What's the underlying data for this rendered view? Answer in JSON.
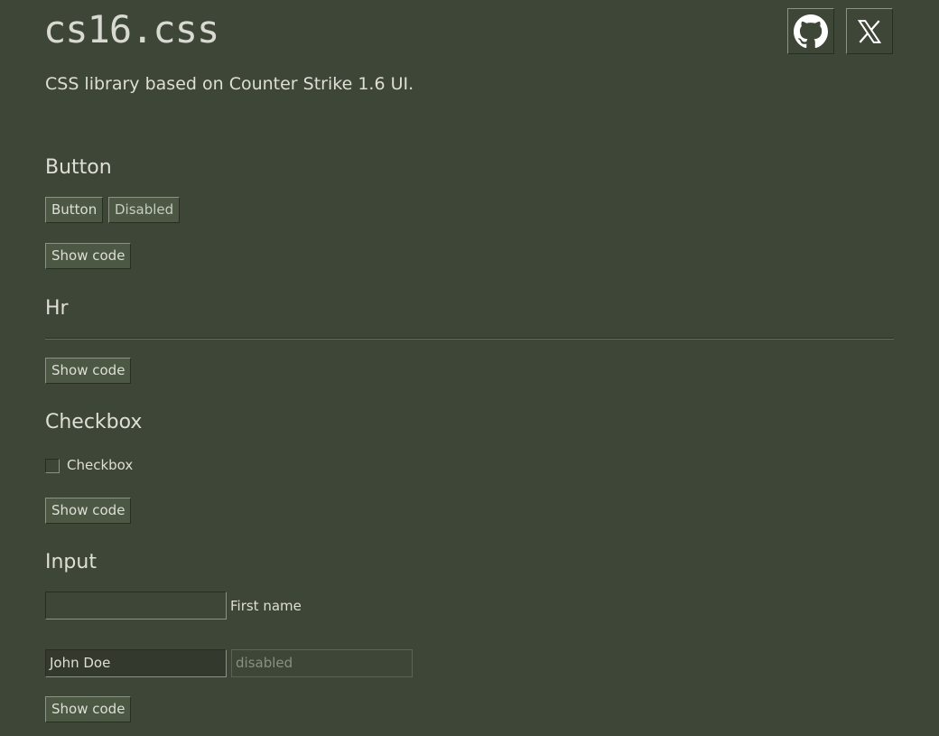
{
  "header": {
    "title": "cs16.css",
    "subtitle": "CSS library based on Counter Strike 1.6 UI.",
    "github_icon": "github-icon",
    "x_icon": "x-twitter-icon"
  },
  "sections": {
    "button": {
      "heading": "Button",
      "button_label": "Button",
      "disabled_label": "Disabled",
      "show_code": "Show code"
    },
    "hr": {
      "heading": "Hr",
      "show_code": "Show code"
    },
    "checkbox": {
      "heading": "Checkbox",
      "label": "Checkbox",
      "checked": false,
      "show_code": "Show code"
    },
    "input": {
      "heading": "Input",
      "first_name_value": "",
      "first_name_label": "First name",
      "filled_value": "John Doe",
      "disabled_placeholder": "disabled",
      "show_code": "Show code"
    }
  },
  "colors": {
    "background": "#3e4637",
    "text": "#dedfd6",
    "border_light": "#8c9284",
    "border_dark": "#292c21"
  }
}
